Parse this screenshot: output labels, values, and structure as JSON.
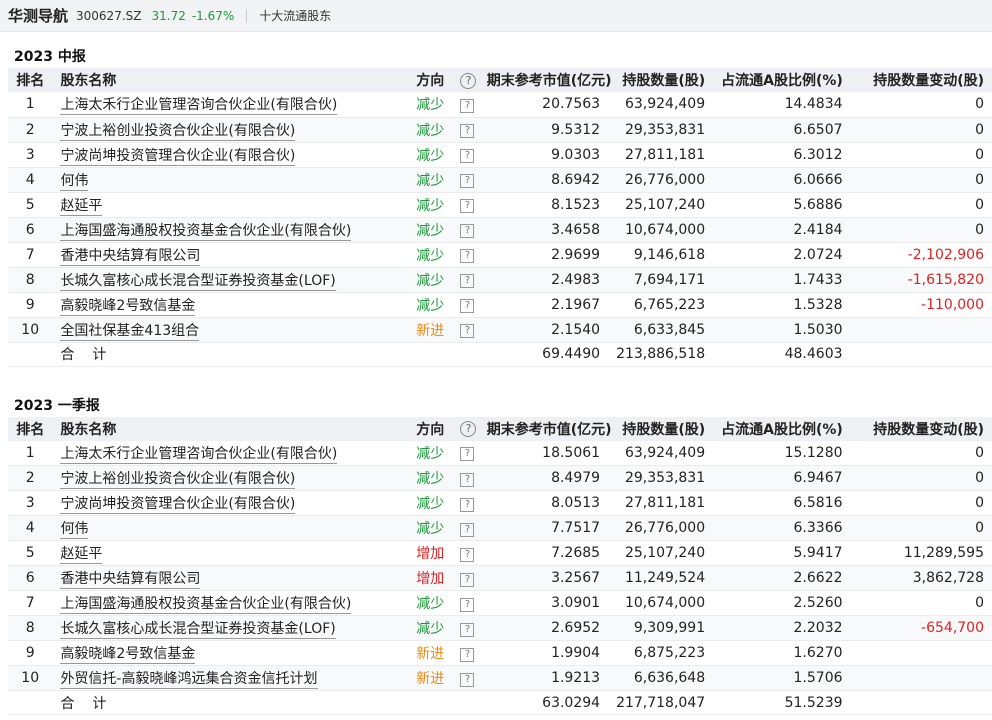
{
  "header": {
    "brand": "华测导航",
    "code": "300627.SZ",
    "price": "31.72",
    "change": "-1.67%",
    "section": "十大流通股东",
    "colors": {
      "down": "#1a9a3a",
      "up": "#e02020",
      "new": "#f08c1a"
    }
  },
  "columns": {
    "rank": "排名",
    "name": "股东名称",
    "direction": "方向",
    "help_glyph": "?",
    "market_value": "期末参考市值(亿元)",
    "shares": "持股数量(股)",
    "ratio": "占流通A股比例(%)",
    "change": "持股数量变动(股)"
  },
  "row_help_glyph": "?",
  "sections": [
    {
      "title": "2023 中报",
      "rows": [
        {
          "rank": "1",
          "name": "上海太禾行企业管理咨询合伙企业(有限合伙)",
          "direction": "减少",
          "dir_type": "down",
          "market_value": "20.7563",
          "shares": "63,924,409",
          "ratio": "14.4834",
          "change": "0",
          "change_neg": false
        },
        {
          "rank": "2",
          "name": "宁波上裕创业投资合伙企业(有限合伙)",
          "direction": "减少",
          "dir_type": "down",
          "market_value": "9.5312",
          "shares": "29,353,831",
          "ratio": "6.6507",
          "change": "0",
          "change_neg": false
        },
        {
          "rank": "3",
          "name": "宁波尚坤投资管理合伙企业(有限合伙)",
          "direction": "减少",
          "dir_type": "down",
          "market_value": "9.0303",
          "shares": "27,811,181",
          "ratio": "6.3012",
          "change": "0",
          "change_neg": false
        },
        {
          "rank": "4",
          "name": "何伟",
          "direction": "减少",
          "dir_type": "down",
          "market_value": "8.6942",
          "shares": "26,776,000",
          "ratio": "6.0666",
          "change": "0",
          "change_neg": false
        },
        {
          "rank": "5",
          "name": "赵延平",
          "direction": "减少",
          "dir_type": "down",
          "market_value": "8.1523",
          "shares": "25,107,240",
          "ratio": "5.6886",
          "change": "0",
          "change_neg": false
        },
        {
          "rank": "6",
          "name": "上海国盛海通股权投资基金合伙企业(有限合伙)",
          "direction": "减少",
          "dir_type": "down",
          "market_value": "3.4658",
          "shares": "10,674,000",
          "ratio": "2.4184",
          "change": "0",
          "change_neg": false
        },
        {
          "rank": "7",
          "name": "香港中央结算有限公司",
          "direction": "减少",
          "dir_type": "down",
          "market_value": "2.9699",
          "shares": "9,146,618",
          "ratio": "2.0724",
          "change": "-2,102,906",
          "change_neg": true
        },
        {
          "rank": "8",
          "name": "长城久富核心成长混合型证券投资基金(LOF)",
          "direction": "减少",
          "dir_type": "down",
          "market_value": "2.4983",
          "shares": "7,694,171",
          "ratio": "1.7433",
          "change": "-1,615,820",
          "change_neg": true
        },
        {
          "rank": "9",
          "name": "高毅晓峰2号致信基金",
          "direction": "减少",
          "dir_type": "down",
          "market_value": "2.1967",
          "shares": "6,765,223",
          "ratio": "1.5328",
          "change": "-110,000",
          "change_neg": true
        },
        {
          "rank": "10",
          "name": "全国社保基金413组合",
          "direction": "新进",
          "dir_type": "new",
          "market_value": "2.1540",
          "shares": "6,633,845",
          "ratio": "1.5030",
          "change": "",
          "change_neg": false
        }
      ],
      "total": {
        "label": "合计",
        "market_value": "69.4490",
        "shares": "213,886,518",
        "ratio": "48.4603"
      }
    },
    {
      "title": "2023 一季报",
      "rows": [
        {
          "rank": "1",
          "name": "上海太禾行企业管理咨询合伙企业(有限合伙)",
          "direction": "减少",
          "dir_type": "down",
          "market_value": "18.5061",
          "shares": "63,924,409",
          "ratio": "15.1280",
          "change": "0",
          "change_neg": false
        },
        {
          "rank": "2",
          "name": "宁波上裕创业投资合伙企业(有限合伙)",
          "direction": "减少",
          "dir_type": "down",
          "market_value": "8.4979",
          "shares": "29,353,831",
          "ratio": "6.9467",
          "change": "0",
          "change_neg": false
        },
        {
          "rank": "3",
          "name": "宁波尚坤投资管理合伙企业(有限合伙)",
          "direction": "减少",
          "dir_type": "down",
          "market_value": "8.0513",
          "shares": "27,811,181",
          "ratio": "6.5816",
          "change": "0",
          "change_neg": false
        },
        {
          "rank": "4",
          "name": "何伟",
          "direction": "减少",
          "dir_type": "down",
          "market_value": "7.7517",
          "shares": "26,776,000",
          "ratio": "6.3366",
          "change": "0",
          "change_neg": false
        },
        {
          "rank": "5",
          "name": "赵延平",
          "direction": "增加",
          "dir_type": "up",
          "market_value": "7.2685",
          "shares": "25,107,240",
          "ratio": "5.9417",
          "change": "11,289,595",
          "change_neg": false
        },
        {
          "rank": "6",
          "name": "香港中央结算有限公司",
          "direction": "增加",
          "dir_type": "up",
          "market_value": "3.2567",
          "shares": "11,249,524",
          "ratio": "2.6622",
          "change": "3,862,728",
          "change_neg": false
        },
        {
          "rank": "7",
          "name": "上海国盛海通股权投资基金合伙企业(有限合伙)",
          "direction": "减少",
          "dir_type": "down",
          "market_value": "3.0901",
          "shares": "10,674,000",
          "ratio": "2.5260",
          "change": "0",
          "change_neg": false
        },
        {
          "rank": "8",
          "name": "长城久富核心成长混合型证券投资基金(LOF)",
          "direction": "减少",
          "dir_type": "down",
          "market_value": "2.6952",
          "shares": "9,309,991",
          "ratio": "2.2032",
          "change": "-654,700",
          "change_neg": true
        },
        {
          "rank": "9",
          "name": "高毅晓峰2号致信基金",
          "direction": "新进",
          "dir_type": "new",
          "market_value": "1.9904",
          "shares": "6,875,223",
          "ratio": "1.6270",
          "change": "",
          "change_neg": false
        },
        {
          "rank": "10",
          "name": "外贸信托-高毅晓峰鸿远集合资金信托计划",
          "direction": "新进",
          "dir_type": "new",
          "market_value": "1.9213",
          "shares": "6,636,648",
          "ratio": "1.5706",
          "change": "",
          "change_neg": false
        }
      ],
      "total": {
        "label": "合计",
        "market_value": "63.0294",
        "shares": "217,718,047",
        "ratio": "51.5239"
      }
    }
  ]
}
